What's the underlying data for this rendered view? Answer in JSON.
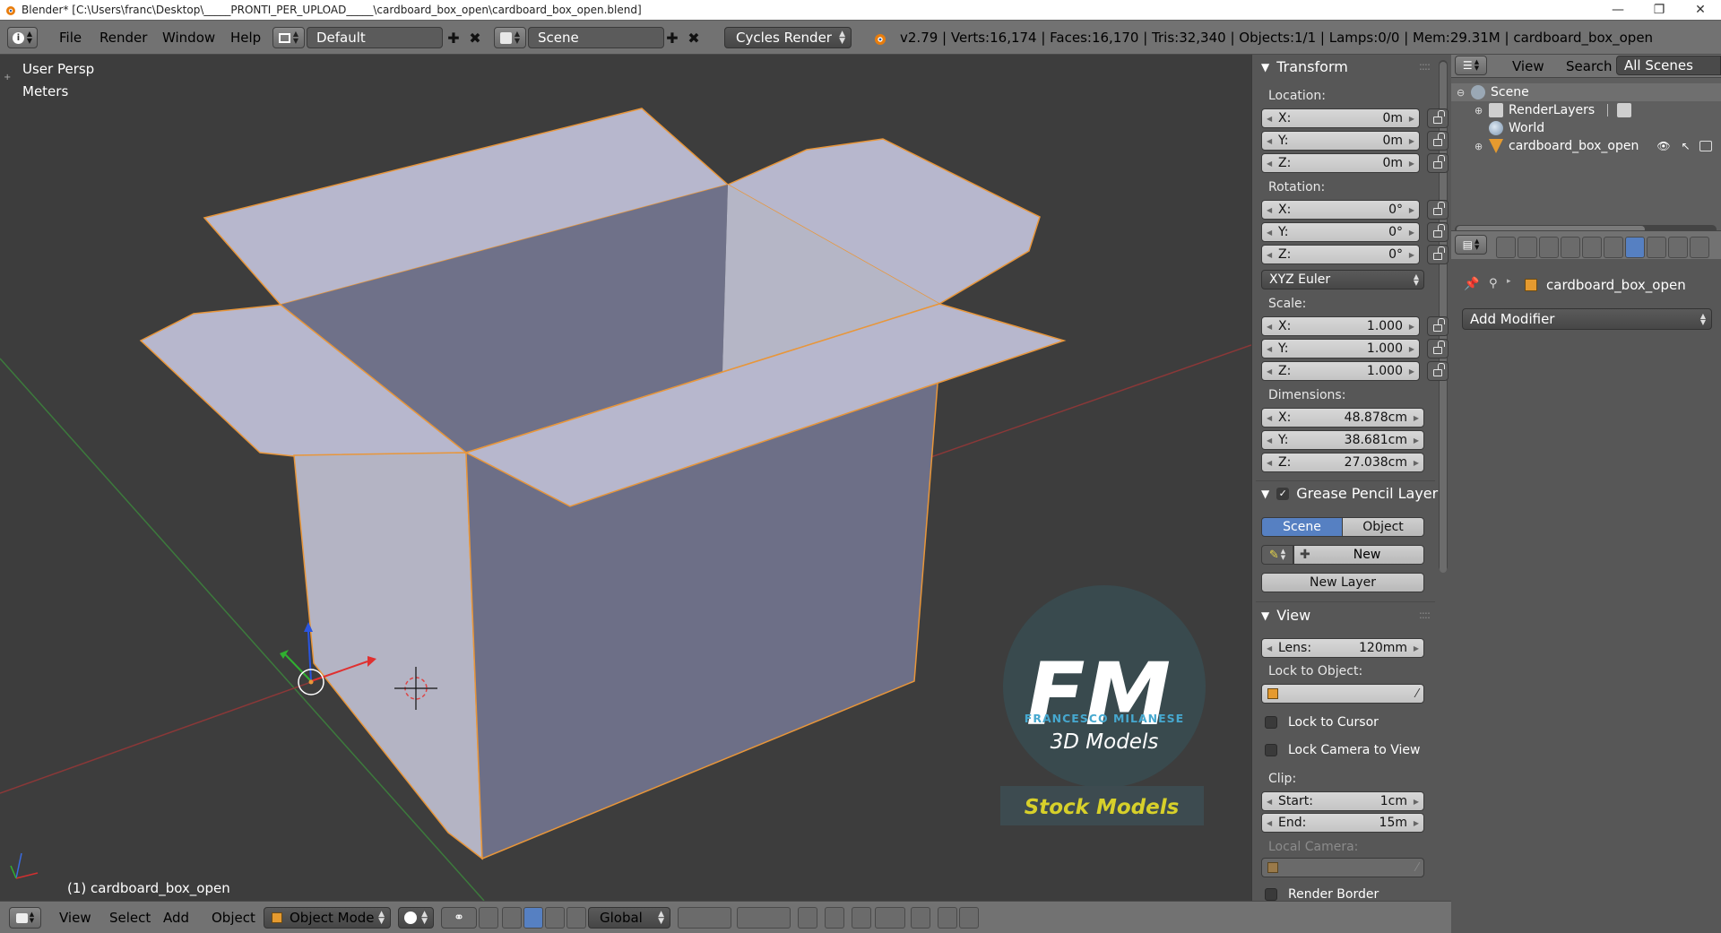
{
  "window": {
    "title": "Blender* [C:\\Users\\franc\\Desktop\\_____PRONTI_PER_UPLOAD_____\\cardboard_box_open\\cardboard_box_open.blend]",
    "controls": [
      "—",
      "❐",
      "✕"
    ]
  },
  "info_header": {
    "menus": [
      "File",
      "Render",
      "Window",
      "Help"
    ],
    "screen_layout": "Default",
    "scene": "Scene",
    "render_engine": "Cycles Render",
    "stats": "v2.79 | Verts:16,174 | Faces:16,170 | Tris:32,340 | Objects:1/1 | Lamps:0/0 | Mem:29.31M | cardboard_box_open"
  },
  "viewport": {
    "view_name": "User Persp",
    "units": "Meters",
    "active_object": "(1) cardboard_box_open",
    "watermark": {
      "initials": "FM",
      "author": "FRANCESCO MILANESE",
      "tagline": "3D Models",
      "banner": "Stock Models"
    }
  },
  "n_panel": {
    "transform": {
      "title": "Transform",
      "location_label": "Location:",
      "location": [
        {
          "axis": "X:",
          "value": "0m"
        },
        {
          "axis": "Y:",
          "value": "0m"
        },
        {
          "axis": "Z:",
          "value": "0m"
        }
      ],
      "rotation_label": "Rotation:",
      "rotation": [
        {
          "axis": "X:",
          "value": "0°"
        },
        {
          "axis": "Y:",
          "value": "0°"
        },
        {
          "axis": "Z:",
          "value": "0°"
        }
      ],
      "rotation_mode": "XYZ Euler",
      "scale_label": "Scale:",
      "scale": [
        {
          "axis": "X:",
          "value": "1.000"
        },
        {
          "axis": "Y:",
          "value": "1.000"
        },
        {
          "axis": "Z:",
          "value": "1.000"
        }
      ],
      "dimensions_label": "Dimensions:",
      "dimensions": [
        {
          "axis": "X:",
          "value": "48.878cm"
        },
        {
          "axis": "Y:",
          "value": "38.681cm"
        },
        {
          "axis": "Z:",
          "value": "27.038cm"
        }
      ]
    },
    "grease_pencil": {
      "title": "Grease Pencil Layer",
      "tabs": [
        "Scene",
        "Object"
      ],
      "active_tab": "Scene",
      "new_label": "New",
      "new_layer_label": "New Layer"
    },
    "view": {
      "title": "View",
      "lens_label": "Lens:",
      "lens_value": "120mm",
      "lock_to_object_label": "Lock to Object:",
      "lock_to_cursor": "Lock to Cursor",
      "lock_camera_to_view": "Lock Camera to View",
      "clip_label": "Clip:",
      "clip_start_label": "Start:",
      "clip_start": "1cm",
      "clip_end_label": "End:",
      "clip_end": "15m",
      "local_camera_label": "Local Camera:",
      "render_border": "Render Border"
    }
  },
  "outliner": {
    "menus": [
      "View",
      "Search"
    ],
    "display_mode": "All Scenes",
    "tree": [
      {
        "label": "Scene",
        "level": 0
      },
      {
        "label": "RenderLayers",
        "level": 1
      },
      {
        "label": "World",
        "level": 1
      },
      {
        "label": "cardboard_box_open",
        "level": 1
      }
    ]
  },
  "properties": {
    "context_object": "cardboard_box_open",
    "add_modifier": "Add Modifier"
  },
  "bottom_header": {
    "menus": [
      "View",
      "Select",
      "Add",
      "Object"
    ],
    "mode": "Object Mode",
    "orientation": "Global"
  },
  "colors": {
    "box_light": "#b4b4c9",
    "box_dark": "#6d6f87",
    "selection_outline": "#e8963a",
    "active_tab": "#5680c2",
    "watermark_banner": "#d7d02a"
  }
}
